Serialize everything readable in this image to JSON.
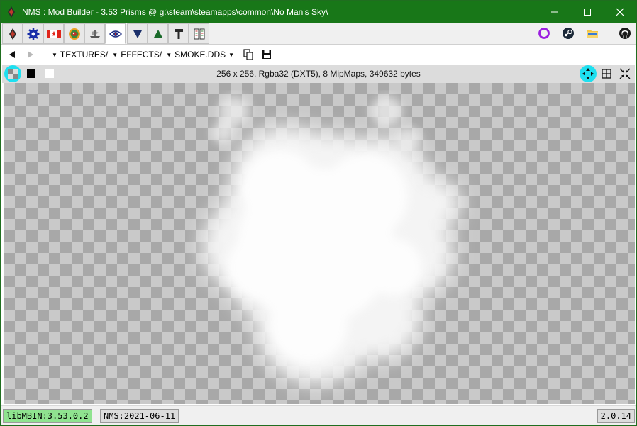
{
  "window": {
    "title": "NMS : Mod Builder - 3.53 Prisms @ g:\\steam\\steamapps\\common\\No Man's Sky\\",
    "app_icon": "nms-logo-icon",
    "controls": [
      "minimize-icon",
      "maximize-icon",
      "close-icon"
    ]
  },
  "tabs": [
    {
      "icon": "nms-logo-icon",
      "active": false
    },
    {
      "icon": "gear-icon",
      "active": false
    },
    {
      "icon": "canada-flag-icon",
      "active": false
    },
    {
      "icon": "color-wheel-icon",
      "active": false
    },
    {
      "icon": "ship-icon",
      "active": false
    },
    {
      "icon": "eye-icon",
      "active": true
    },
    {
      "icon": "triangle-down-icon",
      "active": false
    },
    {
      "icon": "triangle-up-icon",
      "active": false
    },
    {
      "icon": "hammer-icon",
      "active": false
    },
    {
      "icon": "diff-icon",
      "active": false
    }
  ],
  "external_links": [
    "purple-ring-icon",
    "steam-icon",
    "folder-icon",
    "github-icon"
  ],
  "path": {
    "crumbs": [
      "TEXTURES/",
      "EFFECTS/",
      "SMOKE.DDS"
    ],
    "icons": [
      "back-icon",
      "forward-icon",
      "copy-icon",
      "save-icon"
    ]
  },
  "info": {
    "text": "256 x 256,  Rgba32 (DXT5),  8 MipMaps,  349632 bytes",
    "left_buttons": [
      "checker-bg-icon",
      "black-bg-icon",
      "white-bg-icon"
    ],
    "right_buttons": [
      "fit-move-icon",
      "grid-icon",
      "actual-size-icon"
    ]
  },
  "status": {
    "libmbin": "libMBIN:3.53.0.2",
    "nms": "NMS:2021-06-11",
    "version": "2.0.14"
  },
  "colors": {
    "titlebar": "#187718",
    "accent_cyan": "#1ee0f0",
    "status_green": "#8fe38f"
  }
}
